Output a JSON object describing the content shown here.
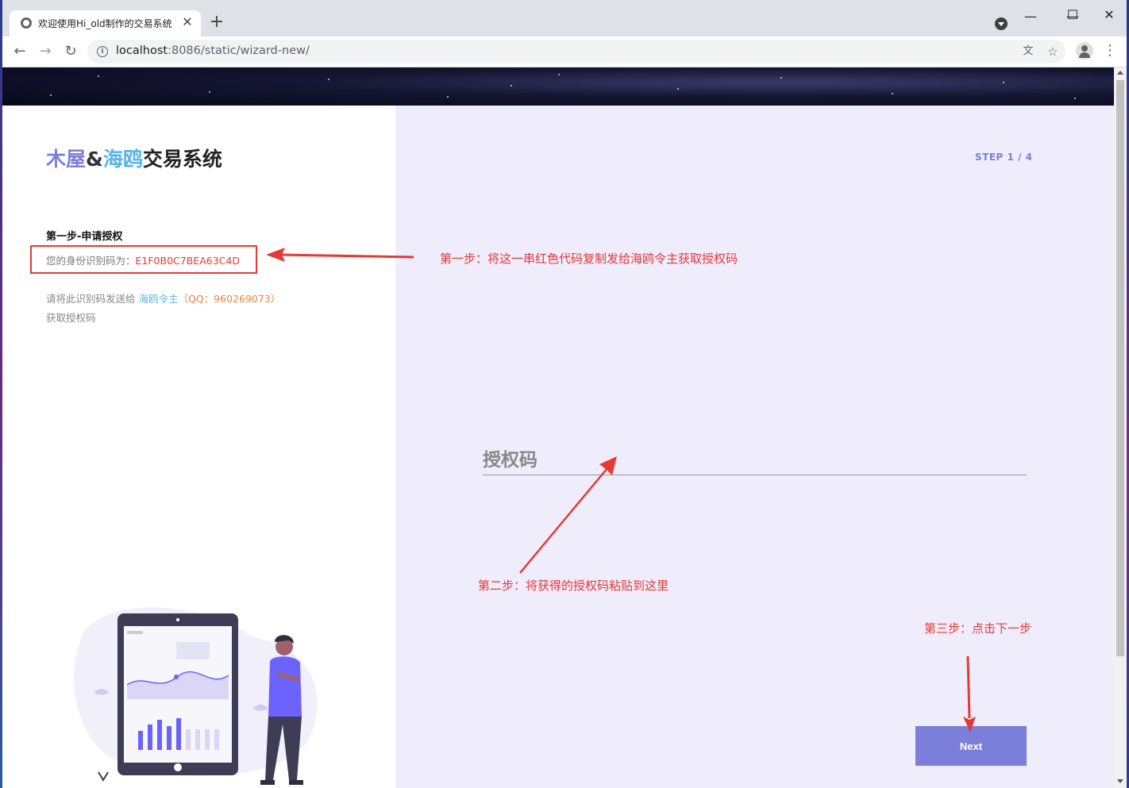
{
  "browser": {
    "tab_title": "欢迎使用Hi_old制作的交易系统",
    "url_host": "localhost",
    "url_rest": ":8086/static/wizard-new/"
  },
  "logo": {
    "part1": "木屋",
    "part2": "&",
    "part3": "海鸥",
    "part4": "交易系统"
  },
  "left": {
    "step_title": "第一步-申请授权",
    "id_label": "您的身份识别码为：",
    "id_value": "E1F0B0C7BEA63C4D",
    "instr_prefix": "请将此识别码发送给 ",
    "instr_lord": "海鸥令主",
    "instr_qq": "（QQ：960269073）",
    "instr_suffix": "获取授权码"
  },
  "right": {
    "step_counter": "STEP 1 / 4",
    "field_label": "授权码",
    "next_label": "Next"
  },
  "annotations": {
    "a1": "第一步：将这一串红色代码复制发给海鸥令主获取授权码",
    "a2": "第二步：将获得的授权码粘贴到这里",
    "a3": "第三步：点击下一步"
  },
  "colors": {
    "accent": "#7b7fd9",
    "annotation_red": "#e53935",
    "right_bg": "#efedfc"
  }
}
